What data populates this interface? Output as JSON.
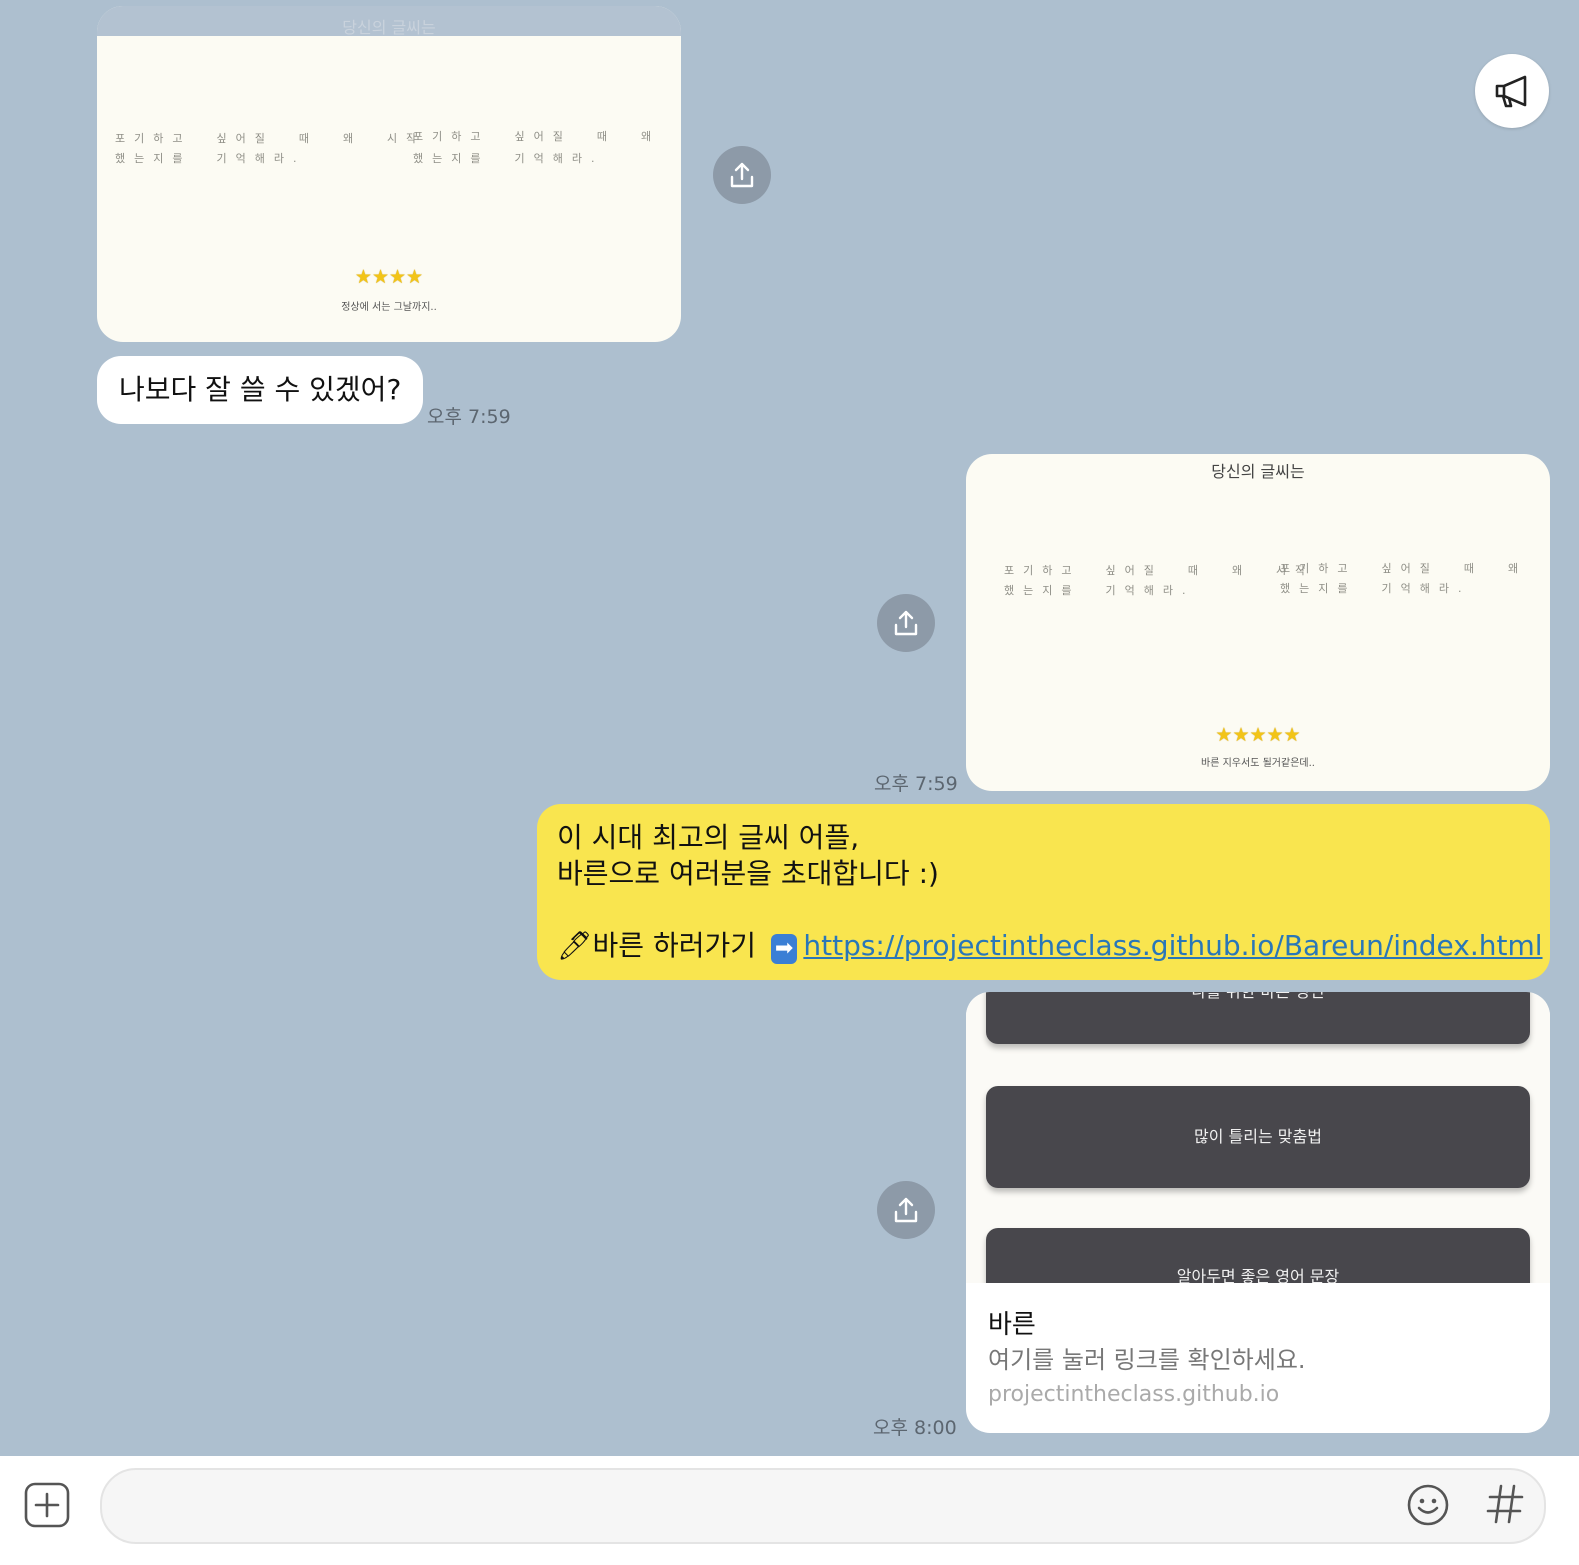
{
  "messages": {
    "received_image": {
      "title": "당신의 글씨는",
      "left_line1": "포기하고  싶어질  때  왜  시작",
      "left_line2": "했는지를  기억해라.",
      "right_line1": "포기하고  싶어질  때  왜  시작",
      "right_line2": "했는지를  기억해라.",
      "stars": "★★★★",
      "caption": "정상에 서는 그날까지.."
    },
    "received_text": {
      "text": "나보다 잘 쓸 수 있겠어?",
      "time": "오후 7:59"
    },
    "sent_image": {
      "title": "당신의 글씨는",
      "left_line1": "포기하고  싶어질  때  왜  시작",
      "left_line2": "했는지를  기억해라.",
      "right_line1": "포기하고  싶어질  때  왜  시작",
      "right_line2": "했는지를  기억해라.",
      "stars": "★★★★★",
      "caption": "바른 지우서도 될거같은데..",
      "time": "오후 7:59"
    },
    "sent_text": {
      "line1": "이 시대 최고의 글씨 어플,",
      "line2": "바른으로 여러분을 초대합니다 :)",
      "cta_emoji": "🖊",
      "cta_label": "바른 하러가기",
      "arrow_emoji": "➡",
      "url": "https://projectintheclass.github.io/Bareun/index.html"
    },
    "link_preview": {
      "btn1": "나를 위한 바른 명언",
      "btn2": "많이 틀리는 맞춤법",
      "btn3": "알아두면 좋은 영어 문장",
      "title": "바른",
      "description": "여기를 눌러 링크를 확인하세요.",
      "domain": "projectintheclass.github.io",
      "time": "오후 8:00"
    }
  },
  "composer": {
    "placeholder": ""
  },
  "icons": {
    "announcement": "megaphone-icon",
    "share": "share-icon",
    "add": "plus-square-icon",
    "emoji": "smiley-icon",
    "hashtag": "hashtag-icon"
  },
  "colors": {
    "chat_background": "#adbfcf",
    "sent_bubble": "#f9e54f",
    "received_bubble": "#ffffff",
    "link": "#2a77b8"
  }
}
